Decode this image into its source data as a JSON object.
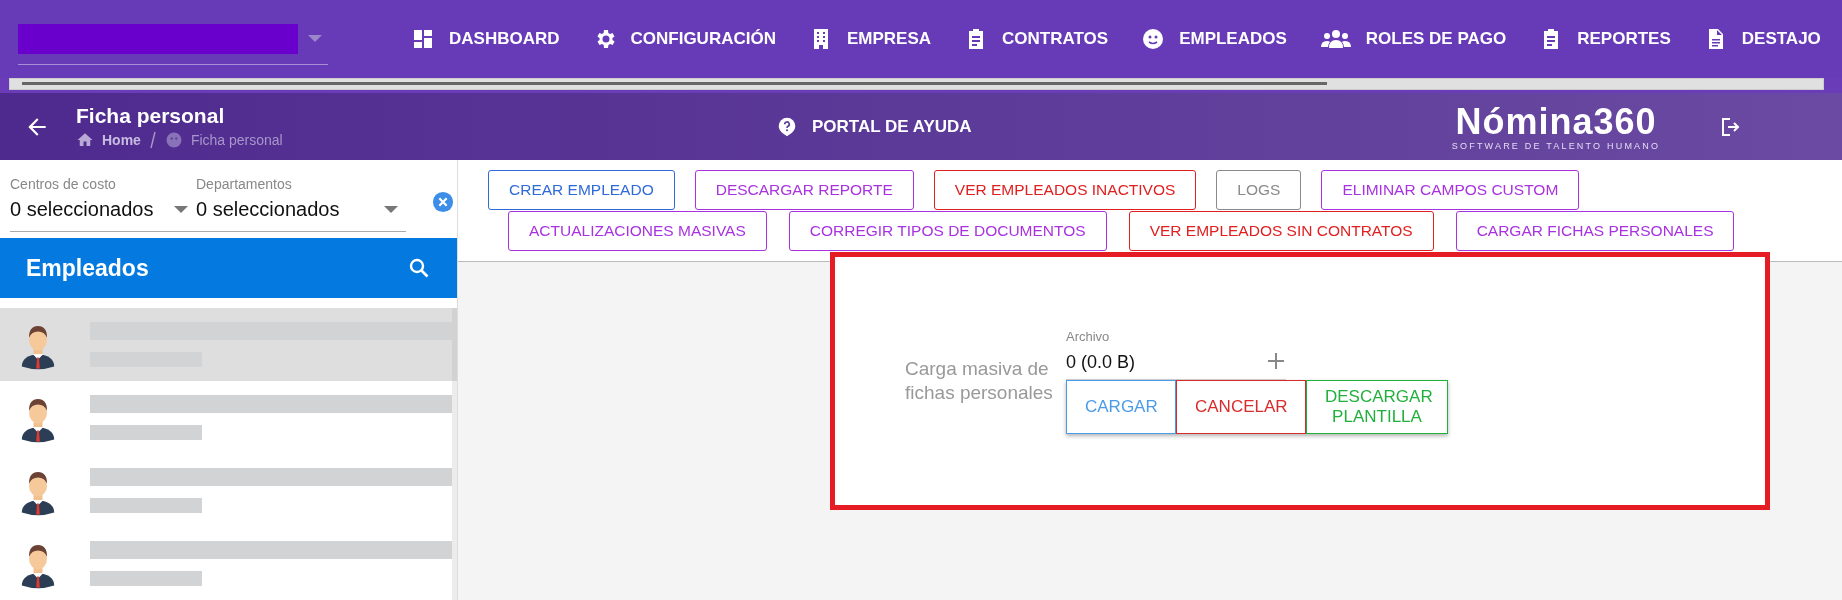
{
  "nav": {
    "items": [
      {
        "label": "DASHBOARD"
      },
      {
        "label": "CONFIGURACIÓN"
      },
      {
        "label": "EMPRESA"
      },
      {
        "label": "CONTRATOS"
      },
      {
        "label": "EMPLEADOS"
      },
      {
        "label": "ROLES DE PAGO"
      },
      {
        "label": "REPORTES"
      },
      {
        "label": "DESTAJO"
      }
    ]
  },
  "header": {
    "title": "Ficha personal",
    "breadcrumb": [
      "Home",
      "Ficha personal"
    ],
    "help": "PORTAL DE AYUDA",
    "logo": "Nómina360",
    "logo_tagline": "SOFTWARE DE TALENTO HUMANO"
  },
  "filters": [
    {
      "label": "Centros de costo",
      "value": "0 seleccionados"
    },
    {
      "label": "Departamentos",
      "value": "0 seleccionados"
    }
  ],
  "employees": {
    "title": "Empleados",
    "rows": [
      {
        "selected": true
      },
      {
        "selected": false
      },
      {
        "selected": false
      },
      {
        "selected": false
      }
    ]
  },
  "toolbar": [
    [
      {
        "label": "CREAR EMPLEADO",
        "color": "#2f6ad9"
      },
      {
        "label": "DESCARGAR REPORTE",
        "color": "#a832e0"
      },
      {
        "label": "VER EMPLEADOS INACTIVOS",
        "color": "#e02020"
      },
      {
        "label": "LOGS",
        "color": "#8a8a8a"
      },
      {
        "label": "ELIMINAR CAMPOS CUSTOM",
        "color": "#a832e0"
      }
    ],
    [
      {
        "label": "ACTUALIZACIONES MASIVAS",
        "color": "#a832e0"
      },
      {
        "label": "CORREGIR TIPOS DE DOCUMENTOS",
        "color": "#a832e0"
      },
      {
        "label": "VER EMPLEADOS SIN CONTRATOS",
        "color": "#e02020"
      },
      {
        "label": "CARGAR FICHAS PERSONALES",
        "color": "#a832e0"
      }
    ]
  ],
  "upload": {
    "label": "Carga masiva de fichas personales",
    "file_label": "Archivo",
    "file_value": "0 (0.0 B)",
    "buttons": [
      {
        "label": "CARGAR",
        "color": "#4a9be8"
      },
      {
        "label": "CANCELAR",
        "color": "#d92b2b"
      },
      {
        "label": "DESCARGAR PLANTILLA",
        "color": "#22b03c"
      }
    ]
  }
}
